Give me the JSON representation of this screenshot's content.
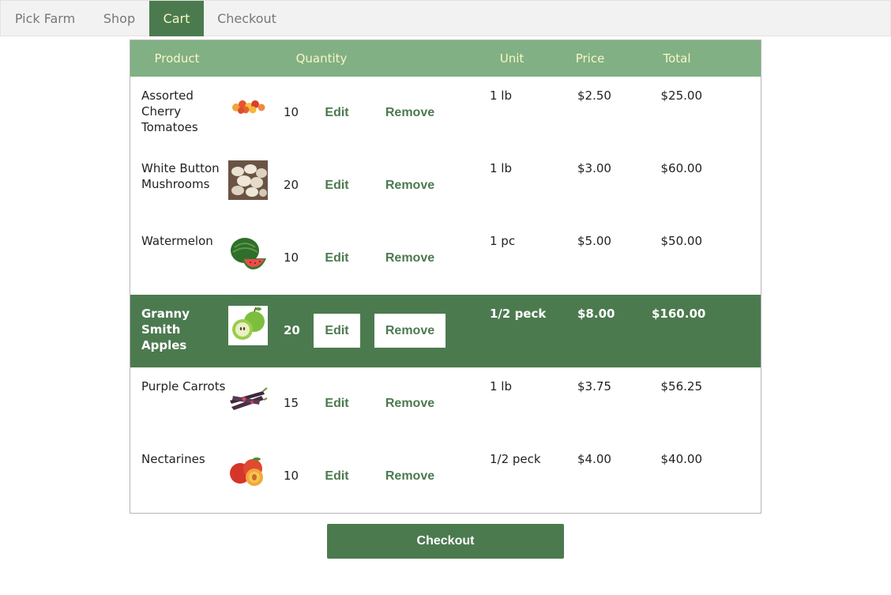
{
  "nav": {
    "items": [
      {
        "label": "Pick Farm"
      },
      {
        "label": "Shop"
      },
      {
        "label": "Cart"
      },
      {
        "label": "Checkout"
      }
    ],
    "active": "Cart"
  },
  "cart": {
    "headers": {
      "product": "Product",
      "quantity": "Quantity",
      "unit": "Unit",
      "price": "Price",
      "total": "Total"
    },
    "edit_label": "Edit",
    "remove_label": "Remove",
    "selected_row": 3,
    "rows": [
      {
        "name": "Assorted Cherry Tomatoes",
        "image": "cherry-tomatoes-image",
        "qty": "10",
        "unit": "1 lb",
        "price": "$2.50",
        "total": "$25.00"
      },
      {
        "name": "White Button Mushrooms",
        "image": "mushrooms-image",
        "qty": "20",
        "unit": "1 lb",
        "price": "$3.00",
        "total": "$60.00"
      },
      {
        "name": "Watermelon",
        "image": "watermelon-image",
        "qty": "10",
        "unit": "1 pc",
        "price": "$5.00",
        "total": "$50.00"
      },
      {
        "name": "Granny Smith Apples",
        "image": "green-apples-image",
        "qty": "20",
        "unit": "1/2 peck",
        "price": "$8.00",
        "total": "$160.00"
      },
      {
        "name": "Purple Carrots",
        "image": "purple-carrots-image",
        "qty": "15",
        "unit": "1 lb",
        "price": "$3.75",
        "total": "$56.25"
      },
      {
        "name": "Nectarines",
        "image": "nectarines-image",
        "qty": "10",
        "unit": "1/2 peck",
        "price": "$4.00",
        "total": "$40.00"
      }
    ]
  },
  "checkout_label": "Checkout",
  "colors": {
    "accent": "#4c7a4f",
    "header": "#81b084",
    "header_text": "#f7f7c4"
  }
}
